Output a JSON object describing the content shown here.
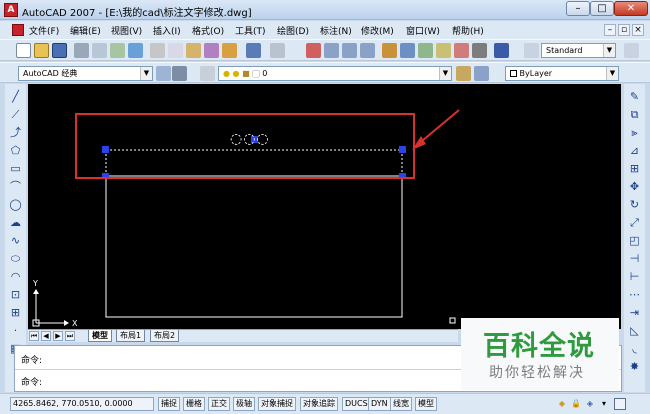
{
  "window": {
    "title": "AutoCAD 2007 - [E:\\我的cad\\标注文字修改.dwg]",
    "controls": {
      "minimize": "–",
      "maximize": "□",
      "close": "✕"
    }
  },
  "menubar": {
    "items": [
      "文件(F)",
      "编辑(E)",
      "视图(V)",
      "插入(I)",
      "格式(O)",
      "工具(T)",
      "绘图(D)",
      "标注(N)",
      "修改(M)",
      "窗口(W)",
      "帮助(H)"
    ],
    "mdi_controls": [
      "–",
      "▫",
      "×"
    ]
  },
  "toolbars": {
    "workspace_select": "AutoCAD 经典",
    "layer_select": "0",
    "text_style_select": "Standard",
    "color_select": "ByLayer"
  },
  "layout_tabs": [
    "模型",
    "布局1",
    "布局2"
  ],
  "command": {
    "line1": "命令:",
    "line2": "命令:"
  },
  "watermark": {
    "title": "百科全说",
    "subtitle": "助你轻松解决"
  },
  "statusbar": {
    "coordinates": "4265.8462, 770.0510, 0.0000",
    "buttons": [
      "捕捉",
      "栅格",
      "正交",
      "极轴",
      "对象捕捉",
      "对象追踪",
      "DUCS",
      "DYN",
      "线宽",
      "模型"
    ]
  },
  "ucs": {
    "x_label": "X",
    "y_label": "Y"
  },
  "colors": {
    "highlight_box": "#d8302d",
    "grip": "#2a43e6",
    "canvas": "#000000",
    "watermark_green": "#2f9a3e"
  },
  "icons": {
    "left_toolbar": [
      "line-icon",
      "construction-line-icon",
      "polyline-icon",
      "polygon-icon",
      "rectangle-icon",
      "arc-icon",
      "circle-icon",
      "revision-cloud-icon",
      "spline-icon",
      "ellipse-icon",
      "ellipse-arc-icon",
      "insert-block-icon",
      "make-block-icon",
      "point-icon",
      "hatch-icon"
    ],
    "right_toolbar": [
      "erase-icon",
      "copy-icon",
      "mirror-icon",
      "offset-icon",
      "array-icon",
      "move-icon",
      "rotate-icon",
      "scale-icon",
      "stretch-icon",
      "trim-icon",
      "extend-icon",
      "break-icon",
      "join-icon",
      "chamfer-icon",
      "fillet-icon",
      "explode-icon"
    ]
  }
}
